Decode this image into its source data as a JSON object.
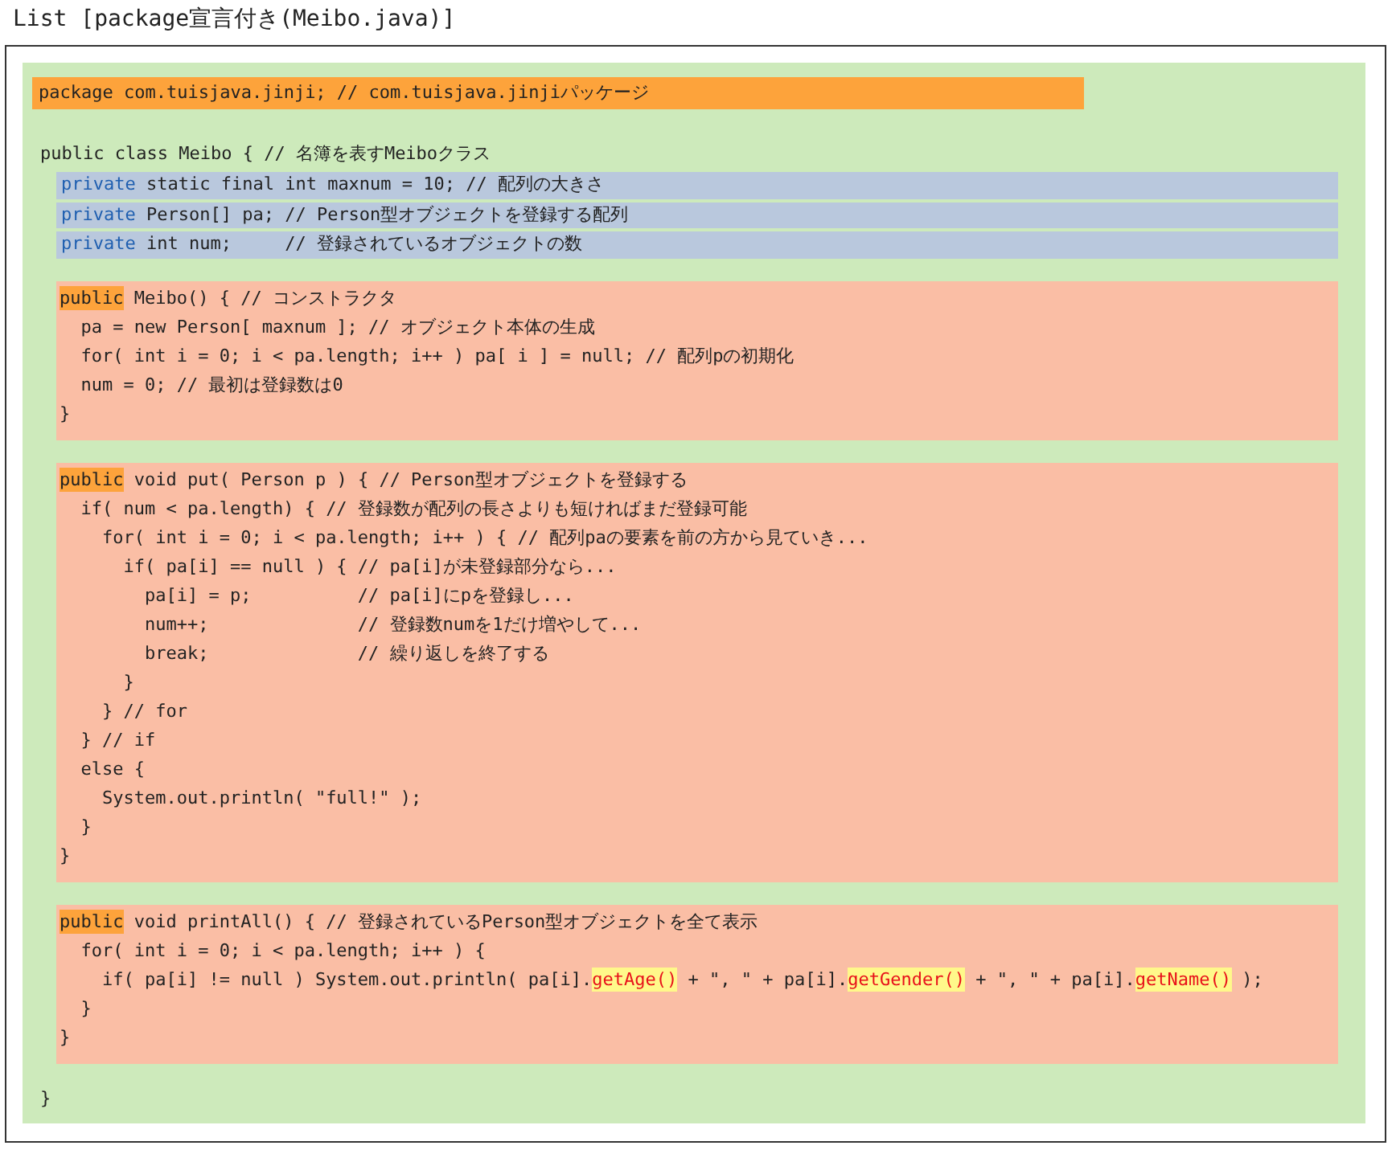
{
  "title": "List [package宣言付き(Meibo.java)]",
  "blocks": [
    {
      "kind": "package",
      "lines": [
        [
          {
            "kind": "plain",
            "text": "package com.tuisjava.jinji; // com.tuisjava.jinjiパッケージ"
          }
        ]
      ]
    },
    {
      "kind": "plain",
      "lines": [
        [
          {
            "kind": "plain",
            "text": "public class Meibo { // 名簿を表すMeiboクラス"
          }
        ]
      ]
    },
    {
      "kind": "field",
      "lines": [
        [
          {
            "kind": "modifier",
            "text": "private"
          },
          {
            "kind": "plain",
            "text": " static final int maxnum = 10; // 配列の大きさ"
          }
        ],
        [
          {
            "kind": "modifier",
            "text": "private"
          },
          {
            "kind": "plain",
            "text": " Person[] pa; // Person型オブジェクトを登録する配列"
          }
        ],
        [
          {
            "kind": "modifier",
            "text": "private"
          },
          {
            "kind": "plain",
            "text": " int num;     // 登録されているオブジェクトの数"
          }
        ]
      ]
    },
    {
      "kind": "method",
      "lines": [
        [
          {
            "kind": "keyword",
            "text": "public"
          },
          {
            "kind": "plain",
            "text": " Meibo() { // コンストラクタ"
          }
        ],
        [
          {
            "kind": "plain",
            "text": "  pa = new Person[ maxnum ]; // オブジェクト本体の生成"
          }
        ],
        [
          {
            "kind": "plain",
            "text": "  for( int i = 0; i < pa.length; i++ ) pa[ i ] = null; // 配列pの初期化"
          }
        ],
        [
          {
            "kind": "plain",
            "text": "  num = 0; // 最初は登録数は0"
          }
        ],
        [
          {
            "kind": "plain",
            "text": "}"
          }
        ]
      ]
    },
    {
      "kind": "method",
      "lines": [
        [
          {
            "kind": "keyword",
            "text": "public"
          },
          {
            "kind": "plain",
            "text": " void put( Person p ) { // Person型オブジェクトを登録する"
          }
        ],
        [
          {
            "kind": "plain",
            "text": "  if( num < pa.length) { // 登録数が配列の長さよりも短ければまだ登録可能"
          }
        ],
        [
          {
            "kind": "plain",
            "text": "    for( int i = 0; i < pa.length; i++ ) { // 配列paの要素を前の方から見ていき..."
          }
        ],
        [
          {
            "kind": "plain",
            "text": "      if( pa[i] == null ) { // pa[i]が未登録部分なら..."
          }
        ],
        [
          {
            "kind": "plain",
            "text": "        pa[i] = p;          // pa[i]にpを登録し..."
          }
        ],
        [
          {
            "kind": "plain",
            "text": "        num++;              // 登録数numを1だけ増やして..."
          }
        ],
        [
          {
            "kind": "plain",
            "text": "        break;              // 繰り返しを終了する"
          }
        ],
        [
          {
            "kind": "plain",
            "text": "      }"
          }
        ],
        [
          {
            "kind": "plain",
            "text": "    } // for"
          }
        ],
        [
          {
            "kind": "plain",
            "text": "  } // if"
          }
        ],
        [
          {
            "kind": "plain",
            "text": "  else {"
          }
        ],
        [
          {
            "kind": "plain",
            "text": "    System.out.println( \"full!\" );"
          }
        ],
        [
          {
            "kind": "plain",
            "text": "  }"
          }
        ],
        [
          {
            "kind": "plain",
            "text": "}"
          }
        ]
      ]
    },
    {
      "kind": "method",
      "lines": [
        [
          {
            "kind": "keyword",
            "text": "public"
          },
          {
            "kind": "plain",
            "text": " void printAll() { // 登録されているPerson型オブジェクトを全て表示"
          }
        ],
        [
          {
            "kind": "plain",
            "text": "  for( int i = 0; i < pa.length; i++ ) {"
          }
        ],
        [
          {
            "kind": "plain",
            "text": "    if( pa[i] != null ) System.out.println( pa[i]."
          },
          {
            "kind": "call",
            "text": "getAge()"
          },
          {
            "kind": "plain",
            "text": " + \", \" + pa[i]."
          },
          {
            "kind": "call",
            "text": "getGender()"
          },
          {
            "kind": "plain",
            "text": " + \", \" + pa[i]."
          },
          {
            "kind": "call",
            "text": "getName()"
          },
          {
            "kind": "plain",
            "text": " );"
          }
        ],
        [
          {
            "kind": "plain",
            "text": "  }"
          }
        ],
        [
          {
            "kind": "plain",
            "text": "}"
          }
        ]
      ]
    },
    {
      "kind": "closing",
      "lines": [
        [
          {
            "kind": "plain",
            "text": "}"
          }
        ]
      ]
    }
  ]
}
